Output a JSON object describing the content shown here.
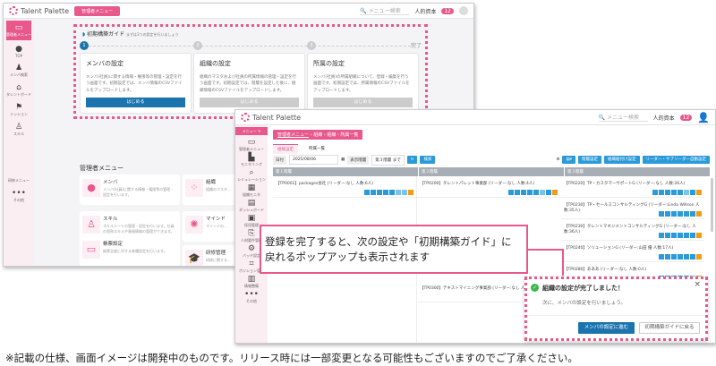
{
  "back": {
    "brand": "Talent Palette",
    "admin_menu_btn": "管理者メニュー",
    "search_placeholder": "メニュー検索",
    "jinteki": "人的資本",
    "badge": "12",
    "sidebar": [
      "管理者メニュー",
      "TOP",
      "メンバ検索",
      "タレントボード",
      "ミッション",
      "スキル",
      "研修メニュー",
      "その他"
    ],
    "guide": {
      "title": "初期構築ガイド",
      "subtitle": "まずは3つの設定を行いましょう",
      "steps": [
        "1",
        "2",
        "3"
      ],
      "done": "完了",
      "cards": [
        {
          "title": "メンバの設定",
          "desc": "メンバ(社員)に関する情報・権限等の管理・設定を行う画面です。初期設定では、メンバ情報のCSVファイルをアップロードします。",
          "button": "はじめる"
        },
        {
          "title": "組織の設定",
          "desc": "組織のマスタおよび社員の所属情報の管理・設定を行う画面です。初期設定では、階層を設定した後に、組織情報のCSVファイルをアップロードします。",
          "button": "はじめる"
        },
        {
          "title": "所属の設定",
          "desc": "メンバ(社員)の所属組織について、登録・編集を行う画面です。初期設定では、所属情報のCSVファイルをアップロードします。",
          "button": "はじめる"
        }
      ]
    },
    "menu_title": "管理者メニュー",
    "menu_cards": [
      {
        "title": "メンバ",
        "desc": "メンバ(社員)に関する情報・権限等の管理・設定を行います。",
        "icon": "person-icon"
      },
      {
        "title": "組織",
        "desc": "組織のマスタ…",
        "icon": "org-icon"
      },
      {
        "title": "スキル",
        "desc": "スキルシートの管理・設定を行います。社員の習熟スキルや資格情報の管理ができます。",
        "icon": "skill-icon"
      },
      {
        "title": "マインド",
        "desc": "マインドの…",
        "icon": "mind-icon"
      },
      {
        "title": "帳票設定",
        "desc": "帳票全般に対する各種設定を行います。",
        "icon": "monitor-icon"
      },
      {
        "title": "研修管理",
        "desc": "研修に関する…",
        "icon": "graduation-icon"
      }
    ]
  },
  "front": {
    "brand": "Talent Palette",
    "menu_btn": "メニュー",
    "search_placeholder": "メニュー検索",
    "jinteki": "人的資本",
    "badge": "12",
    "sidebar": [
      "管理者メニュー",
      "モニタリング",
      "シミュレーション",
      "組織モニタ",
      "ダッシュボード",
      "採用管理",
      "人材要件管理",
      "バッチ設定",
      "ポジション管理",
      "情報整備",
      "その他"
    ],
    "breadcrumb": [
      "管理者メニュー",
      "組織",
      "組織・所属一覧"
    ],
    "tabs": [
      "組織設定",
      "所属一覧"
    ],
    "toolbar": {
      "date_label": "日付",
      "date_value": "2025/08/06",
      "level_label": "表示階層",
      "level_value": "第３階層 まで",
      "search": "検索",
      "b1": "階層設定",
      "b2": "組織紐付け設定",
      "b3": "リーダー・サブリーダー自動設定"
    },
    "columns": [
      "第１階層",
      "第２階層",
      "第３階層"
    ],
    "rows": {
      "c1": [
        "【TP0001】packages会社 (リーダー:なし 人数:6人)"
      ],
      "c2": [
        "【TP0200】タレントパレット事業部 (リーダー:なし 人数:4人)",
        "【TP0300】テキストマイニング事業部 (リーダー:なし 人数:0人)"
      ],
      "c3": [
        "【TP0220】TP・カスタマーサポートG (リーダー:なし 人数:26人)",
        "【TP0230】TP・セールスコンサルティングG (リーダー:Linda Willson 人数:35人)",
        "【TP0230】タレントマネジメントコンサルティングG (リーダー:なし 人数:36人)",
        "【TP0240】ソリューションG (リーダー:山田 優 人数:17人)",
        "【TP0280】あああ (リーダー:なし 人数:0人)"
      ]
    },
    "popup": {
      "title": "組織の設定が完了しました！",
      "body": "次に、メンバの設定を行いましょう。",
      "primary": "メンバの設定に進む",
      "secondary": "初期構築ガイドに戻る"
    }
  },
  "callout": {
    "line1": "登録を完了すると、次の設定や「初期構築ガイド」に",
    "line2": "戻れるポップアップも表示されます"
  },
  "footnote": "※記載の仕様、画面イメージは開発中のものです。リリース時には一部変更となる可能性もございますのでご了承ください。",
  "colors": {
    "pink": "#e8588a",
    "blue": "#1b74ad",
    "green": "#3cb54a"
  }
}
